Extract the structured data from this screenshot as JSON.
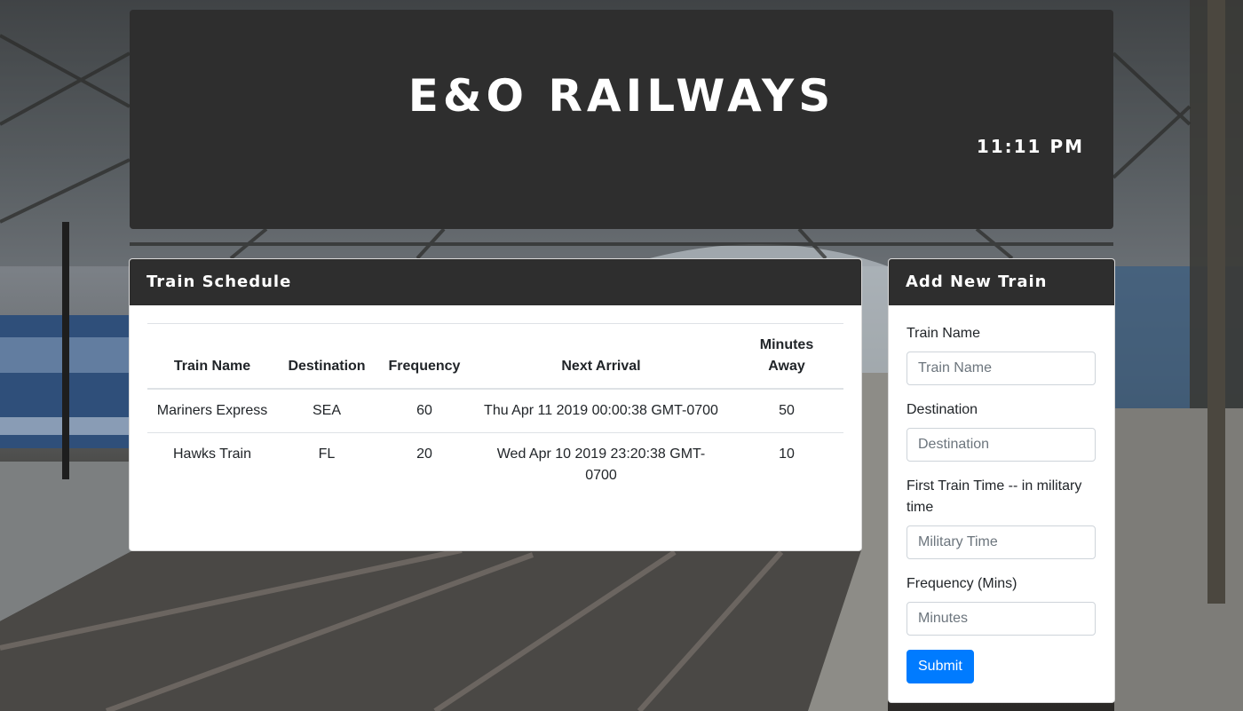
{
  "header": {
    "title": "E&O RAILWAYS",
    "clock": "11:11 PM"
  },
  "schedule": {
    "title": "Train Schedule",
    "columns": [
      "Train Name",
      "Destination",
      "Frequency",
      "Next Arrival",
      "Minutes\nAway"
    ],
    "rows": [
      {
        "train_name": "Mariners Express",
        "destination": "SEA",
        "frequency": "60",
        "next_arrival": "Thu Apr 11 2019 00:00:38 GMT-0700",
        "minutes_away": "50"
      },
      {
        "train_name": "Hawks Train",
        "destination": "FL",
        "frequency": "20",
        "next_arrival": "Wed Apr 10 2019 23:20:38 GMT-0700",
        "minutes_away": "10"
      }
    ]
  },
  "add_train": {
    "title": "Add New Train",
    "fields": [
      {
        "label": "Train Name",
        "placeholder": "Train Name",
        "value": ""
      },
      {
        "label": "Destination",
        "placeholder": "Destination",
        "value": ""
      },
      {
        "label": "First Train Time -- in military time",
        "placeholder": "Military Time",
        "value": ""
      },
      {
        "label": "Frequency (Mins)",
        "placeholder": "Minutes",
        "value": ""
      }
    ],
    "submit_label": "Submit"
  },
  "colors": {
    "panel_dark": "#2e2e2e",
    "submit_blue": "#007bff",
    "card_white": "#ffffff"
  }
}
